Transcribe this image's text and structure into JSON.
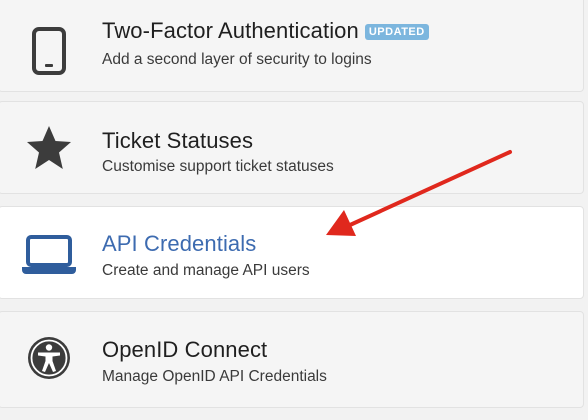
{
  "colors": {
    "badge_bg": "#7cb6de",
    "link": "#3d6bb0",
    "icon_dark": "#3c3c3c",
    "icon_blue": "#2f5d9c",
    "arrow": "#e0281d"
  },
  "items": [
    {
      "title": "Two-Factor Authentication",
      "badge": "UPDATED",
      "subtitle": "Add a second layer of security to logins",
      "icon": "mobile-phone-icon"
    },
    {
      "title": "Ticket Statuses",
      "subtitle": "Customise support ticket statuses",
      "icon": "star-icon"
    },
    {
      "title": "API Credentials",
      "subtitle": "Create and manage API users",
      "icon": "laptop-icon",
      "highlighted": true
    },
    {
      "title": "OpenID Connect",
      "subtitle": "Manage OpenID API Credentials",
      "icon": "accessibility-icon"
    }
  ],
  "annotation": {
    "icon": "red-arrow-icon"
  }
}
